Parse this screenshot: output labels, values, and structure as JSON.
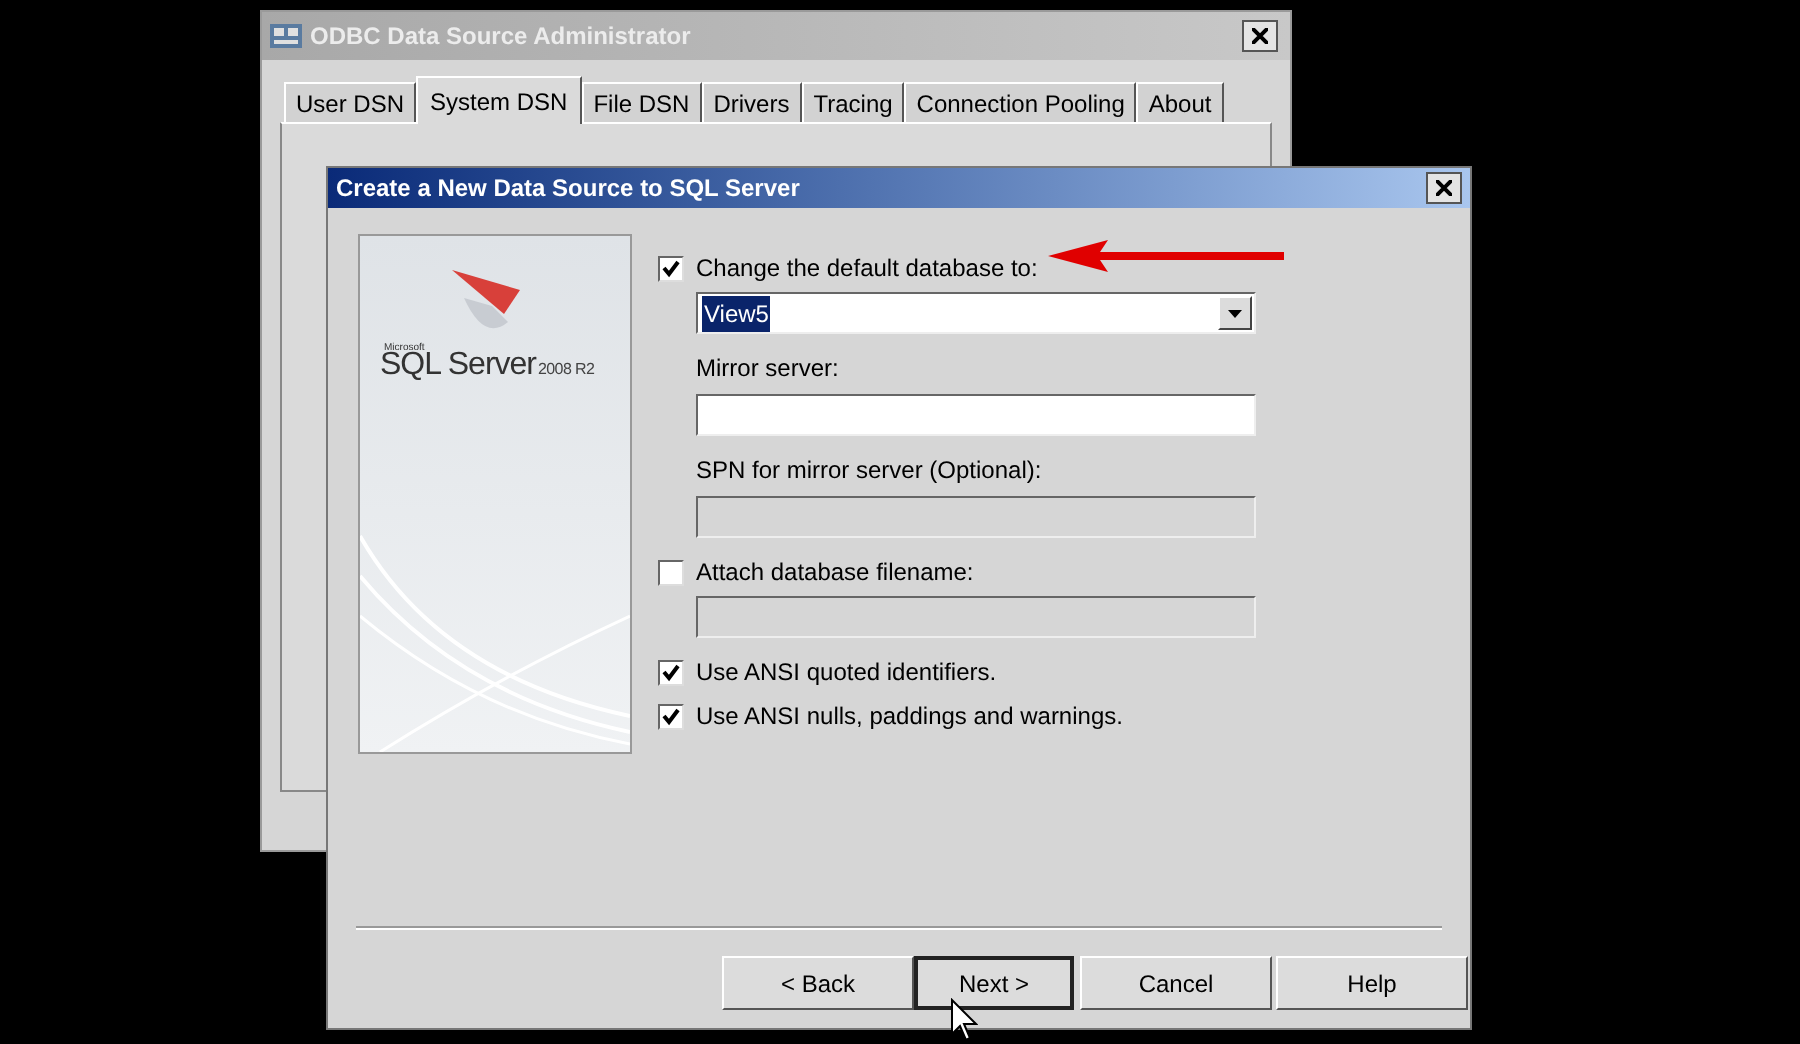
{
  "background_window": {
    "title": "ODBC Data Source Administrator",
    "tabs": [
      {
        "label": "User DSN",
        "selected": false
      },
      {
        "label": "System DSN",
        "selected": true
      },
      {
        "label": "File DSN",
        "selected": false
      },
      {
        "label": "Drivers",
        "selected": false
      },
      {
        "label": "Tracing",
        "selected": false
      },
      {
        "label": "Connection Pooling",
        "selected": false
      },
      {
        "label": "About",
        "selected": false
      }
    ]
  },
  "dialog": {
    "title": "Create a New Data Source to SQL Server",
    "banner": {
      "brand": "Microsoft",
      "product": "SQL Server",
      "version": "2008 R2"
    },
    "fields": [
      {
        "kind": "checkbox",
        "label": "Change the default database to:",
        "checked": true
      },
      {
        "kind": "dropdown",
        "value": "View5",
        "highlighted": true
      },
      {
        "kind": "label",
        "label": "Mirror server:"
      },
      {
        "kind": "textbox",
        "disabled": false
      },
      {
        "kind": "label",
        "label": "SPN for mirror server (Optional):"
      },
      {
        "kind": "textbox",
        "disabled": true
      },
      {
        "kind": "checkbox",
        "label": "Attach database filename:",
        "checked": false
      },
      {
        "kind": "textbox",
        "disabled": true
      },
      {
        "kind": "checkbox",
        "label": "Use ANSI quoted identifiers.",
        "checked": true
      },
      {
        "kind": "checkbox",
        "label": "Use ANSI nulls, paddings and warnings.",
        "checked": true
      }
    ],
    "buttons": [
      {
        "label": "< Back",
        "default": false
      },
      {
        "label": "Next >",
        "default": true
      },
      {
        "label": "Cancel",
        "default": false
      },
      {
        "label": "Help",
        "default": false
      }
    ]
  }
}
